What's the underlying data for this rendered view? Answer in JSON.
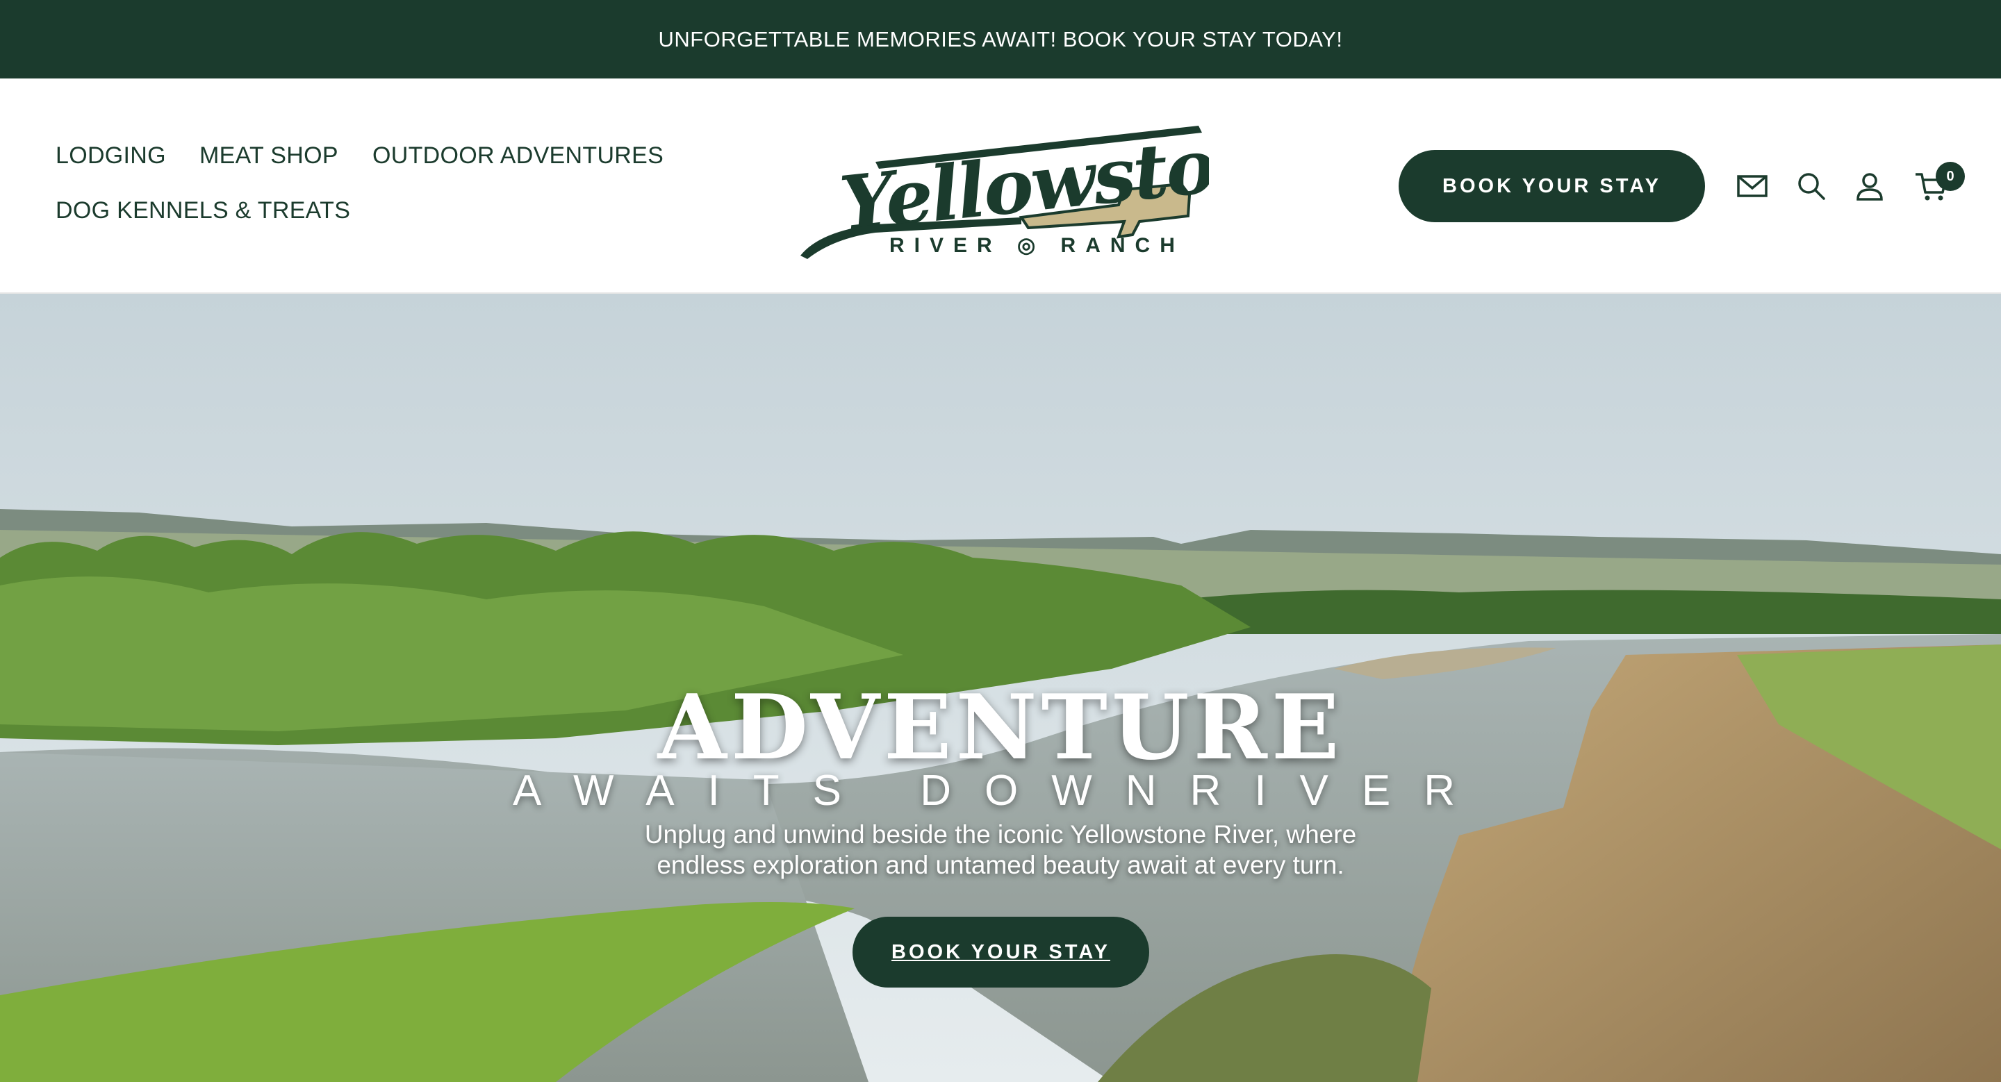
{
  "announcement": {
    "text": "UNFORGETTABLE MEMORIES AWAIT! BOOK YOUR STAY TODAY!"
  },
  "nav": {
    "items": [
      {
        "label": "LODGING"
      },
      {
        "label": "MEAT SHOP"
      },
      {
        "label": "OUTDOOR ADVENTURES"
      },
      {
        "label": "DOG KENNELS & TREATS"
      }
    ]
  },
  "logo": {
    "name": "Yellowstone",
    "tagline": "RIVER RANCH"
  },
  "header": {
    "book_label": "BOOK YOUR STAY",
    "icons": [
      "mail-icon",
      "search-icon",
      "account-icon",
      "cart-icon"
    ],
    "cart_count": "0"
  },
  "hero": {
    "title": "ADVENTURE",
    "subtitle": "AWAITS DOWNRIVER",
    "description": "Unplug and unwind beside the iconic Yellowstone River, where endless exploration and untamed beauty await at every turn.",
    "button_label": "BOOK YOUR STAY"
  },
  "colors": {
    "brand": "#1b3b2d",
    "logo_accent": "#c9b98c"
  }
}
